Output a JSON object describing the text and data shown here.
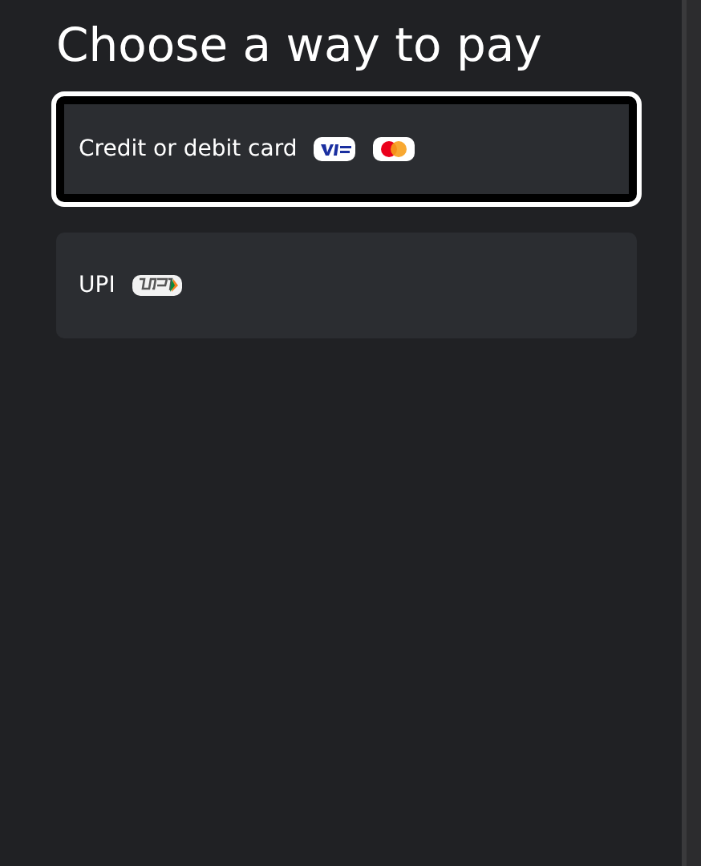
{
  "title": "Choose a way to pay",
  "options": [
    {
      "label": "Credit or debit card",
      "kind": "card",
      "selected": true
    },
    {
      "label": "UPI",
      "kind": "upi",
      "selected": false
    }
  ]
}
